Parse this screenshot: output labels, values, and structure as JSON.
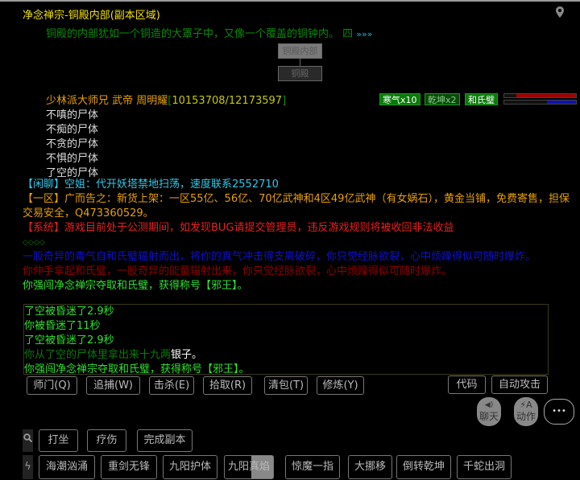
{
  "header": {
    "title": "净念禅宗-铜殿内部(副本区域)",
    "location_icon": "map-pin-icon"
  },
  "room": {
    "description": "铜殿的内部犹如一个铜造的大罩子中，又像一个覆盖的铜钟内。 四",
    "more": "»»»"
  },
  "map": {
    "current": "铜殿内部",
    "exit": "铜殿"
  },
  "npc": {
    "name": "少林派大师兄 武帝 周明耀",
    "hp": "10153708/12173597",
    "buffs": [
      "寒气x10",
      "乾坤x2",
      "和氏璧"
    ],
    "hp_fraction": 0.83,
    "mp_fraction": 0.4,
    "colors": {
      "hp": "#a00000",
      "mp": "#1010b0"
    }
  },
  "corpses": [
    "不嗔的尸体",
    "不痴的尸体",
    "不贪的尸体",
    "不惧的尸体",
    "了空的尸体"
  ],
  "chat": [
    {
      "text": "【闲聊】空姐：代开妖塔禁地扫荡，速度联系2552710",
      "color": "#30c8e8"
    },
    {
      "text": "【一区】广而告之：新货上架：一区55亿、56亿、70亿武神和4区49亿武神（有女娲石），黄金当铺，免费寄售，担保交易安全，Q473360529。",
      "color": "#e8a000"
    },
    {
      "text": "【系统】游戏目前处于公测期间，如发现BUG请提交管理员，违反游戏规则将被收回非法收益",
      "color": "#e82020"
    },
    {
      "text": "◇◇◇◇",
      "color": "#0a8a0a"
    },
    {
      "text": "一股奇异的毒气自和氏璧辐射而出，将你的真气冲击得支离破碎，你只觉经脉欲裂，心中烦躁得似可随时爆炸。",
      "color": "#1010d0"
    },
    {
      "text": "你伸手拿起和氏璧，一股奇异的能量辐射出来，你只觉经脉欲裂，心中烦躁得似可随时爆炸。",
      "color": "#900000"
    },
    {
      "text": "你强闯净念禅宗夺取和氏璧，获得称号【邪王】。",
      "color": "#30e030"
    }
  ],
  "combat": [
    {
      "text": "了空被昏迷了2.9秒",
      "color": "#30e030"
    },
    {
      "text": "你被昏迷了11秒",
      "color": "#30e030"
    },
    {
      "text": "了空被昏迷了2.9秒",
      "color": "#30e030"
    },
    {
      "text": "你从了空的尸体里拿出来十九两",
      "extra": "银子。",
      "color": "#0a7a0a"
    },
    {
      "text": "你强闯净念禅宗夺取和氏璧，获得称号【邪王】。",
      "color": "#30e030"
    }
  ],
  "commands": [
    "师门(Q)",
    "追捕(W)",
    "击杀(E)",
    "拾取(R)",
    "清包(T)",
    "修炼(Y)"
  ],
  "right_buttons": [
    "代码",
    "自动攻击"
  ],
  "round_buttons": {
    "chat": "聊天",
    "action": "动作",
    "action_top": "A",
    "more": "•••"
  },
  "quick": [
    "打坐",
    "疗伤",
    "完成副本"
  ],
  "skills": [
    "海潮汹涌",
    "重剑无锋",
    "九阳护体",
    "九阳真焰",
    "惊魔一指",
    "大挪移",
    "倒转乾坤",
    "千蛇出洞"
  ]
}
